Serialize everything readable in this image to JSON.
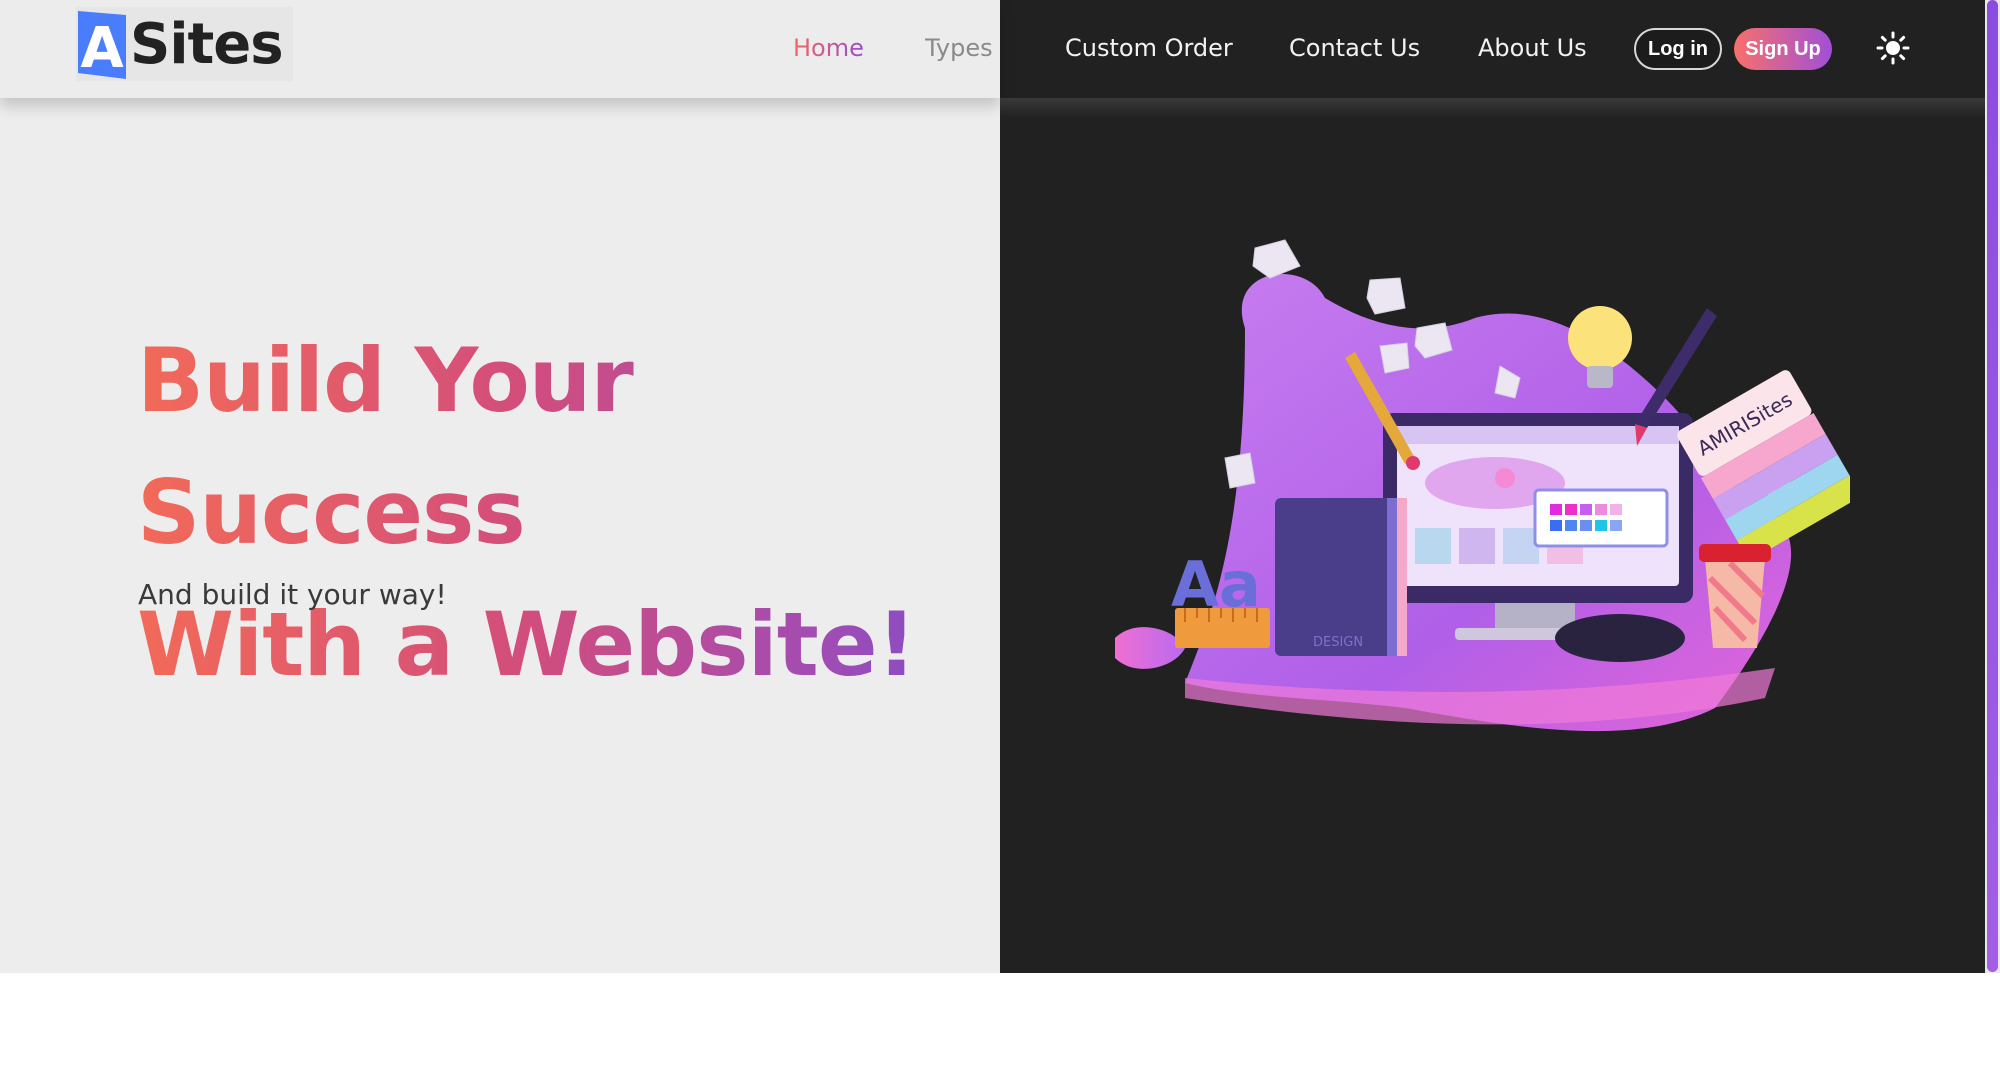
{
  "brand": {
    "logo_letter": "A",
    "logo_text": "Sites",
    "accent_blue": "#4a7dfb"
  },
  "nav": {
    "home": "Home",
    "types": "Types",
    "custom_order": "Custom Order",
    "contact_us": "Contact Us",
    "about_us": "About Us",
    "login": "Log in",
    "signup": "Sign Up",
    "theme_icon": "sun-icon"
  },
  "hero": {
    "title_line1": "Build Your Success",
    "title_line2": "With a Website!",
    "subtitle": "And build it your way!",
    "gradient_start": "#f26a58",
    "gradient_end": "#7c4dcc"
  },
  "illustration": {
    "sign_text": "AMIRISites",
    "letters": "Aa",
    "book_label": "DESIGN"
  },
  "colors": {
    "light_bg": "#eeedee",
    "dark_bg": "#212121",
    "signup_gradient": [
      "#f7706b",
      "#a14fd8"
    ]
  }
}
